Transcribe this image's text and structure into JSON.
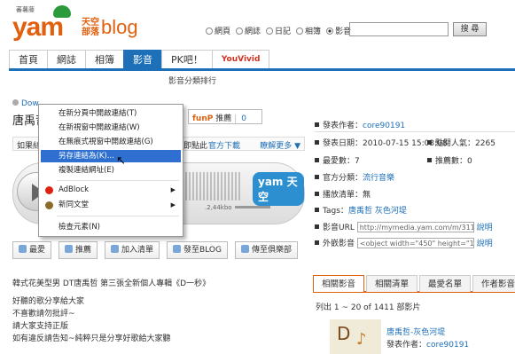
{
  "header": {
    "logo_small": "蕃薯藤",
    "logo_main": "yam",
    "logo_sky": "天空部落",
    "logo_blog": "blog",
    "search_scopes": [
      "網頁",
      "網誌",
      "日記",
      "相簿",
      "影音"
    ],
    "search_selected": "影音",
    "search_placeholder": "",
    "search_button": "搜 尋"
  },
  "nav": {
    "tabs": [
      "首頁",
      "網誌",
      "相簿",
      "影音",
      "PK吧！",
      "YouVivid"
    ],
    "active": "影音",
    "subnav": "影音分類排行"
  },
  "video": {
    "download_label": "Dow",
    "title": "唐禹哲",
    "funp_label": "funP",
    "funp_recommend": "推薦",
    "funp_count": "0",
    "tip_text": "如果絲",
    "tip_middle": "式即點此",
    "tip_link": "官方下載",
    "tip_more": "瞭解更多 ▼",
    "player_time": ".2,44kbo",
    "player_brand": "yam 天空"
  },
  "context_menu": {
    "items": [
      "在新分頁中開啟連結(T)",
      "在新視窗中開啟連結(W)",
      "在無痕式視窗中開啟連結(G)",
      "另存連結為(K)...",
      "複製連結網址(E)",
      "AdBlock",
      "新同文堂",
      "檢查元素(N)"
    ],
    "highlighted": "另存連結為(K)..."
  },
  "actions": {
    "favorite": "最愛",
    "recommend": "推薦",
    "add_list": "加入清單",
    "to_blog": "發至BLOG",
    "to_club": "傳至俱樂部"
  },
  "description": {
    "line1": "韓式花美型男 DT唐禹哲 第三張全新個人專輯《D一秒》",
    "line2": "好聽的歌分享給大家",
    "line3": "不喜歡請勿批評~",
    "line4": "請大家支持正版",
    "line5": "如有違反請告知~純粹只是分享好歌給大家聽"
  },
  "info": {
    "publisher_label": "發表作者：",
    "publisher": "core90191",
    "date_label": "發表日期：",
    "date": "2010-07-15 15:03:08",
    "views_label": "點閱人氣：",
    "views": "2265",
    "fav_label": "最愛數：",
    "fav": "7",
    "recommend_label": "推薦數：",
    "recommend": "0",
    "category_label": "官方分類：",
    "category": "流行音樂",
    "playlist_label": "播放清單：",
    "playlist": "無",
    "tags_label": "Tags：",
    "tags": [
      "唐禹哲",
      "灰色河堤"
    ],
    "url_label": "影音URL",
    "url": "http://mymedia.yam.com/m/3118",
    "url_note": "說明",
    "embed_label": "外嵌影音",
    "embed": "<object width=\"450\" height=\"120",
    "embed_note": "說明"
  },
  "related": {
    "tabs": [
      "相關影音",
      "相關清單",
      "最愛名單",
      "作者影音"
    ],
    "active": "相關影音",
    "count_text": "列出 1 ~ 20 of 1411 部影片",
    "item_title": "唐禹哲-灰色河堤",
    "item_owner_label": "發表作者：",
    "item_owner": "core90191",
    "thumb_text": "D"
  }
}
